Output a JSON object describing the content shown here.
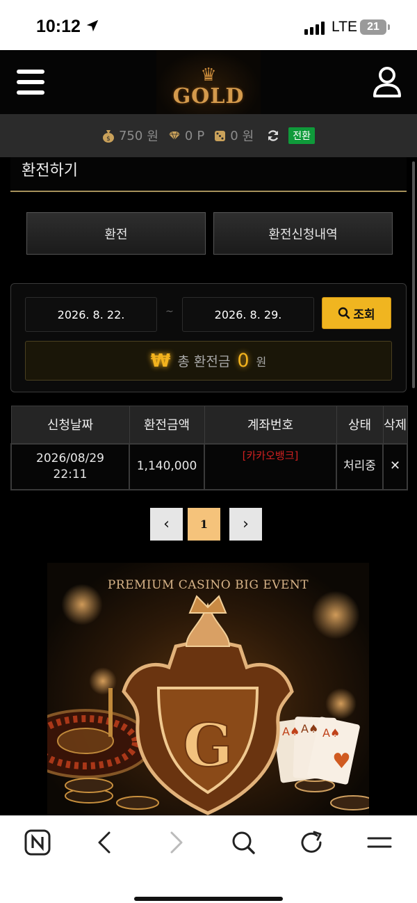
{
  "status_bar": {
    "time": "10:12",
    "network": "LTE",
    "battery": "21"
  },
  "header": {
    "logo_text": "GOLD"
  },
  "balance": {
    "money": "750",
    "money_unit": "원",
    "points": "0",
    "points_unit": "P",
    "chips": "0",
    "chips_unit": "원",
    "convert_label": "전환"
  },
  "page_title": "환전하기",
  "tabs": [
    {
      "label": "환전"
    },
    {
      "label": "환전신청내역"
    }
  ],
  "search": {
    "date_from": "2026. 8. 22.",
    "separator": "~",
    "date_to": "2026. 8. 29.",
    "button_label": "조회"
  },
  "total": {
    "icon": "₩",
    "label": "총 환전금",
    "value": "0",
    "unit": "원"
  },
  "table": {
    "headers": [
      "신청날짜",
      "환전금액",
      "계좌번호",
      "상태",
      "삭제"
    ],
    "rows": [
      {
        "date": "2026/08/29",
        "time": "22:11",
        "amount": "1,140,000",
        "account": "[카카오뱅크]",
        "status": "처리중",
        "delete": "✕"
      }
    ]
  },
  "pagination": {
    "prev": "‹",
    "current": "1",
    "next": "›"
  },
  "banner": {
    "title": "PREMIUM CASINO BIG EVENT",
    "emblem_letter": "G"
  },
  "colors": {
    "accent_gold": "#f0b520",
    "convert_green": "#0f9a3a",
    "account_red": "#d02020",
    "page_active": "#f5c37b"
  },
  "icons": [
    "location-arrow-icon",
    "signal-icon",
    "battery-icon",
    "hamburger-menu-icon",
    "user-icon",
    "money-bag-icon",
    "diamond-icon",
    "dice-icon",
    "refresh-icon",
    "search-icon",
    "won-icon",
    "close-icon",
    "chevron-left-icon",
    "chevron-right-icon",
    "naver-n-icon",
    "back-icon",
    "forward-icon",
    "browser-search-icon",
    "reload-icon",
    "menu-icon"
  ]
}
